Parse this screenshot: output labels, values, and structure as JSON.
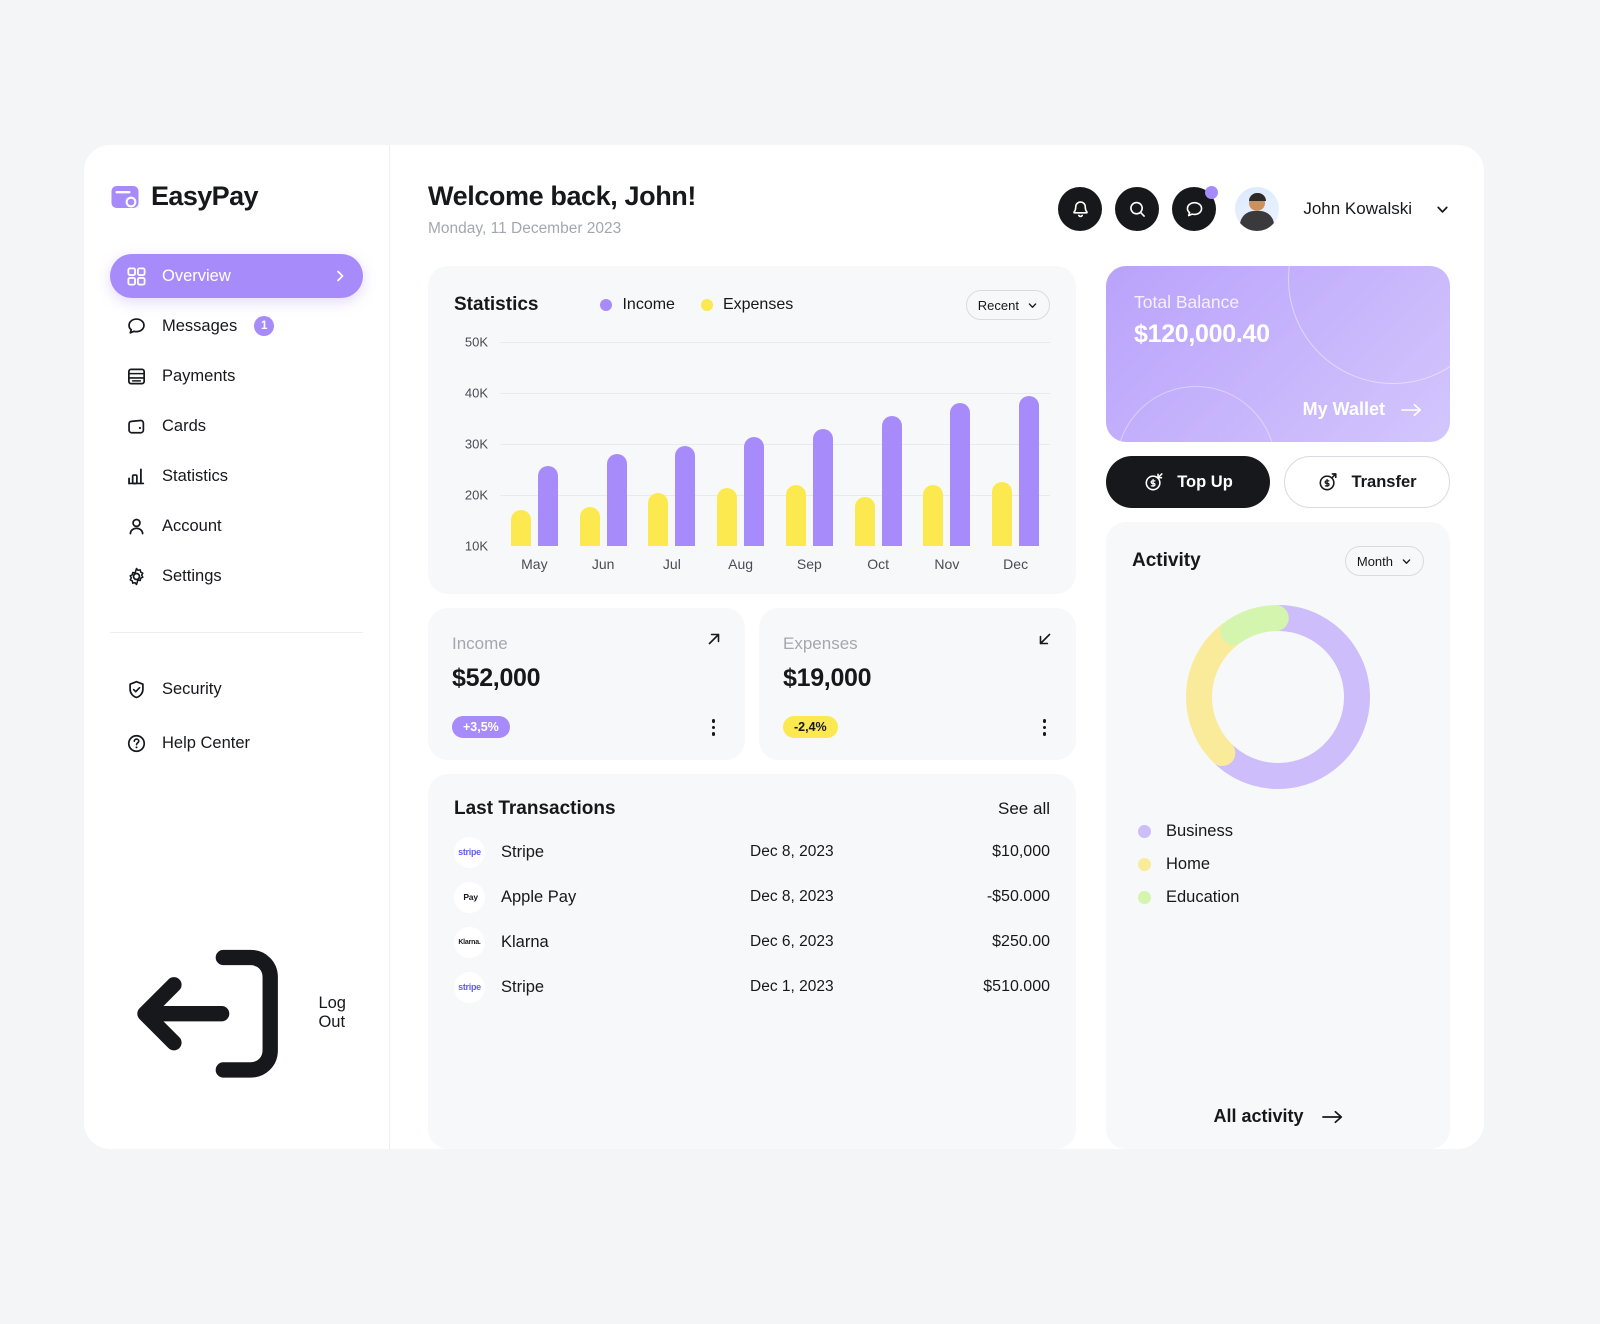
{
  "brand": {
    "name": "EasyPay",
    "logo_icon": "wallet-card-icon"
  },
  "sidebar": {
    "primary": [
      {
        "label": "Overview",
        "icon": "grid-icon",
        "active": true,
        "chevron": "chevron-right-icon"
      },
      {
        "label": "Messages",
        "icon": "chat-bubble-icon",
        "badge": "1"
      },
      {
        "label": "Payments",
        "icon": "bank-list-icon"
      },
      {
        "label": "Cards",
        "icon": "wallet-icon"
      },
      {
        "label": "Statistics",
        "icon": "bar-chart-icon"
      },
      {
        "label": "Account",
        "icon": "user-icon"
      },
      {
        "label": "Settings",
        "icon": "gear-icon"
      }
    ],
    "secondary": [
      {
        "label": "Security",
        "icon": "shield-check-icon"
      },
      {
        "label": "Help Center",
        "icon": "question-circle-icon"
      }
    ],
    "logout": {
      "label": "Log Out",
      "icon": "logout-icon"
    }
  },
  "header": {
    "greeting": "Welcome back, John!",
    "date": "Monday, 11 December 2023",
    "actions": [
      {
        "icon": "bell-icon",
        "name": "notifications"
      },
      {
        "icon": "search-icon",
        "name": "search"
      },
      {
        "icon": "message-icon",
        "name": "messages",
        "has_dot": true
      }
    ],
    "user": {
      "name": "John Kowalski",
      "avatar": "user-avatar",
      "caret": "chevron-down-icon"
    }
  },
  "statistics": {
    "title": "Statistics",
    "range_label": "Recent",
    "legend": [
      {
        "label": "Income",
        "color": "#a78bfa"
      },
      {
        "label": "Expenses",
        "color": "#fbe94f"
      }
    ]
  },
  "chart_data": [
    {
      "type": "bar",
      "title": "Statistics",
      "xlabel": "",
      "ylabel": "",
      "categories": [
        "May",
        "Jun",
        "Jul",
        "Aug",
        "Sep",
        "Oct",
        "Nov",
        "Dec"
      ],
      "series": [
        {
          "name": "Expenses",
          "color": "#fbe94f",
          "values": [
            17000,
            17600,
            20400,
            21300,
            21900,
            19600,
            22000,
            22600
          ]
        },
        {
          "name": "Income",
          "color": "#a78bfa",
          "values": [
            25600,
            28000,
            29600,
            31400,
            33000,
            35400,
            38000,
            39500
          ]
        }
      ],
      "ylim": [
        10000,
        50000
      ],
      "yticks": [
        10000,
        20000,
        30000,
        40000,
        50000
      ],
      "ytick_labels": [
        "10K",
        "20K",
        "30K",
        "40K",
        "50K"
      ],
      "grid": true,
      "legend_position": "top"
    },
    {
      "type": "pie",
      "variant": "donut",
      "title": "Activity",
      "labels": [
        "Business",
        "Home",
        "Education"
      ],
      "values": [
        62,
        28,
        10
      ],
      "colors": [
        "#cdbdfa",
        "#faeb9a",
        "#d4f5ae"
      ],
      "legend_position": "bottom"
    }
  ],
  "kpis": [
    {
      "label": "Income",
      "value": "$52,000",
      "chip": "+3,5%",
      "trend": "up",
      "arrow_icon": "arrow-up-right-icon",
      "menu_icon": "kebab-menu-icon"
    },
    {
      "label": "Expenses",
      "value": "$19,000",
      "chip": "-2,4%",
      "trend": "down",
      "arrow_icon": "arrow-down-left-icon",
      "menu_icon": "kebab-menu-icon"
    }
  ],
  "transactions": {
    "title": "Last Transactions",
    "see_all": "See all",
    "rows": [
      {
        "logo": "stripe",
        "logo_text": "stripe",
        "name": "Stripe",
        "date": "Dec 8, 2023",
        "amount": "$10,000"
      },
      {
        "logo": "apple",
        "logo_text": " Pay",
        "name": "Apple Pay",
        "date": "Dec 8, 2023",
        "amount": "-$50.000"
      },
      {
        "logo": "klarna",
        "logo_text": "Klarna.",
        "name": "Klarna",
        "date": "Dec 6, 2023",
        "amount": "$250.00"
      },
      {
        "logo": "stripe",
        "logo_text": "stripe",
        "name": "Stripe",
        "date": "Dec 1, 2023",
        "amount": "$510.000"
      }
    ]
  },
  "balance": {
    "label": "Total Balance",
    "value": "$120,000.40",
    "link": "My Wallet",
    "link_icon": "arrow-right-icon"
  },
  "actions": {
    "top_up": {
      "label": "Top Up",
      "icon": "dollar-circle-in-icon"
    },
    "transfer": {
      "label": "Transfer",
      "icon": "dollar-circle-out-icon"
    }
  },
  "activity": {
    "title": "Activity",
    "range_label": "Month",
    "legend": [
      {
        "label": "Business",
        "color": "#cdbdfa"
      },
      {
        "label": "Home",
        "color": "#faeb9a"
      },
      {
        "label": "Education",
        "color": "#d4f5ae"
      }
    ],
    "all_link": "All activity",
    "all_link_icon": "arrow-right-icon"
  },
  "colors": {
    "accent": "#a78bfa",
    "yellow": "#fbe94f",
    "dark": "#17181c",
    "page_bg": "#f4f5f7",
    "card_bg": "#f7f8fa"
  }
}
